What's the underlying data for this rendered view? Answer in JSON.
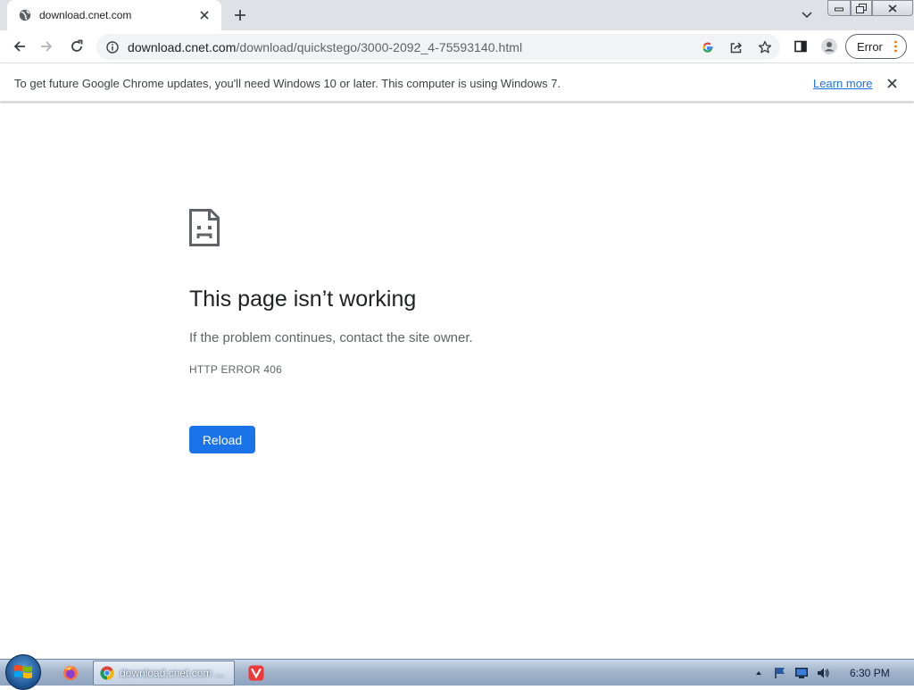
{
  "browser": {
    "tab": {
      "title": "download.cnet.com"
    },
    "omnibox": {
      "host": "download.cnet.com",
      "path": "/download/quickstego/3000-2092_4-75593140.html"
    },
    "error_button": {
      "label": "Error"
    }
  },
  "infobar": {
    "message": "To get future Google Chrome updates, you'll need Windows 10 or later. This computer is using Windows 7.",
    "link": "Learn more"
  },
  "error_page": {
    "title": "This page isn’t working",
    "subtitle": "If the problem continues, contact the site owner.",
    "code": "HTTP ERROR 406",
    "reload_label": "Reload"
  },
  "taskbar": {
    "active_task": {
      "label": "download.cnet.com ..."
    },
    "clock": "6:30 PM"
  },
  "colors": {
    "accent": "#1a73e8",
    "tabstrip": "#dee1e6",
    "text": "#202124",
    "muted": "#5f6368"
  },
  "icons": [
    "globe-icon",
    "close-icon",
    "plus-icon",
    "chevron-down-icon",
    "back-icon",
    "forward-icon",
    "reload-icon",
    "info-icon",
    "google-icon",
    "share-icon",
    "star-icon",
    "side-panel-icon",
    "profile-icon",
    "kebab-menu-icon",
    "sad-page-icon",
    "windows-start-icon",
    "firefox-icon",
    "chrome-icon",
    "vivaldi-icon"
  ]
}
